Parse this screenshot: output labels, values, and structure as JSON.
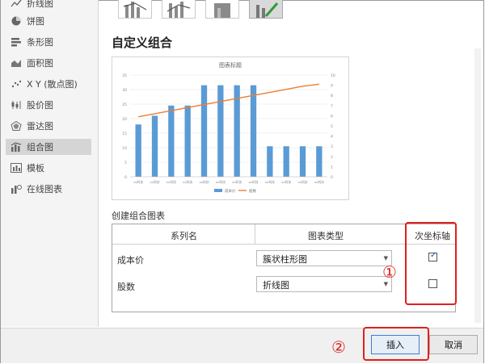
{
  "sidebar": {
    "items": [
      {
        "label": "折线图",
        "icon": "line-chart-icon"
      },
      {
        "label": "饼图",
        "icon": "pie-chart-icon"
      },
      {
        "label": "条形图",
        "icon": "bar-chart-icon"
      },
      {
        "label": "面积图",
        "icon": "area-chart-icon"
      },
      {
        "label": "X Y (散点图)",
        "icon": "scatter-chart-icon"
      },
      {
        "label": "股价图",
        "icon": "stock-chart-icon"
      },
      {
        "label": "雷达图",
        "icon": "radar-chart-icon"
      },
      {
        "label": "组合图",
        "icon": "combo-chart-icon",
        "selected": true
      },
      {
        "label": "模板",
        "icon": "template-icon"
      },
      {
        "label": "在线图表",
        "icon": "online-chart-icon"
      }
    ]
  },
  "main": {
    "heading": "自定义组合",
    "section_label": "创建组合图表"
  },
  "combo_table": {
    "col_series": "系列名",
    "col_type": "图表类型",
    "col_secondary": "次坐标轴",
    "rows": [
      {
        "name": "成本价",
        "type": "簇状柱形图",
        "secondary": true
      },
      {
        "name": "股数",
        "type": "折线图",
        "secondary": false
      }
    ]
  },
  "annotations": {
    "circle1": "①",
    "circle2": "②",
    "highlight_color": "#e0201c"
  },
  "buttons": {
    "insert": "插入",
    "cancel": "取消"
  },
  "chart_data": {
    "type": "bar",
    "title": "图表标题",
    "categories": [
      "xx科技",
      "xx科技",
      "xx科技",
      "xx科技",
      "xx科技",
      "xx科技",
      "xx科技",
      "xx科技",
      "xx科技",
      "xx科技",
      "xx科技",
      "xx科技"
    ],
    "series": [
      {
        "name": "成本价",
        "kind": "bar",
        "axis": "primary",
        "color": "#5b9bd5",
        "values": [
          18,
          21,
          24.5,
          24.5,
          31.5,
          31.5,
          31.5,
          31.5,
          10.5,
          10.5,
          10.5,
          10.5
        ]
      },
      {
        "name": "股数",
        "kind": "line",
        "axis": "secondary",
        "color": "#ed7d31",
        "values": [
          5.9,
          6.2,
          6.5,
          6.8,
          7.1,
          7.4,
          7.7,
          8.0,
          8.3,
          8.6,
          8.9,
          9.1
        ]
      }
    ],
    "yticks": [
      "0",
      "5",
      "10",
      "15",
      "20",
      "25",
      "30",
      "35"
    ],
    "y2ticks": [
      "0",
      "1",
      "2",
      "3",
      "4",
      "5",
      "6",
      "7",
      "8",
      "9",
      "10"
    ],
    "ylim": [
      0,
      35
    ],
    "y2lim": [
      0,
      10
    ],
    "legend": "bottom"
  }
}
